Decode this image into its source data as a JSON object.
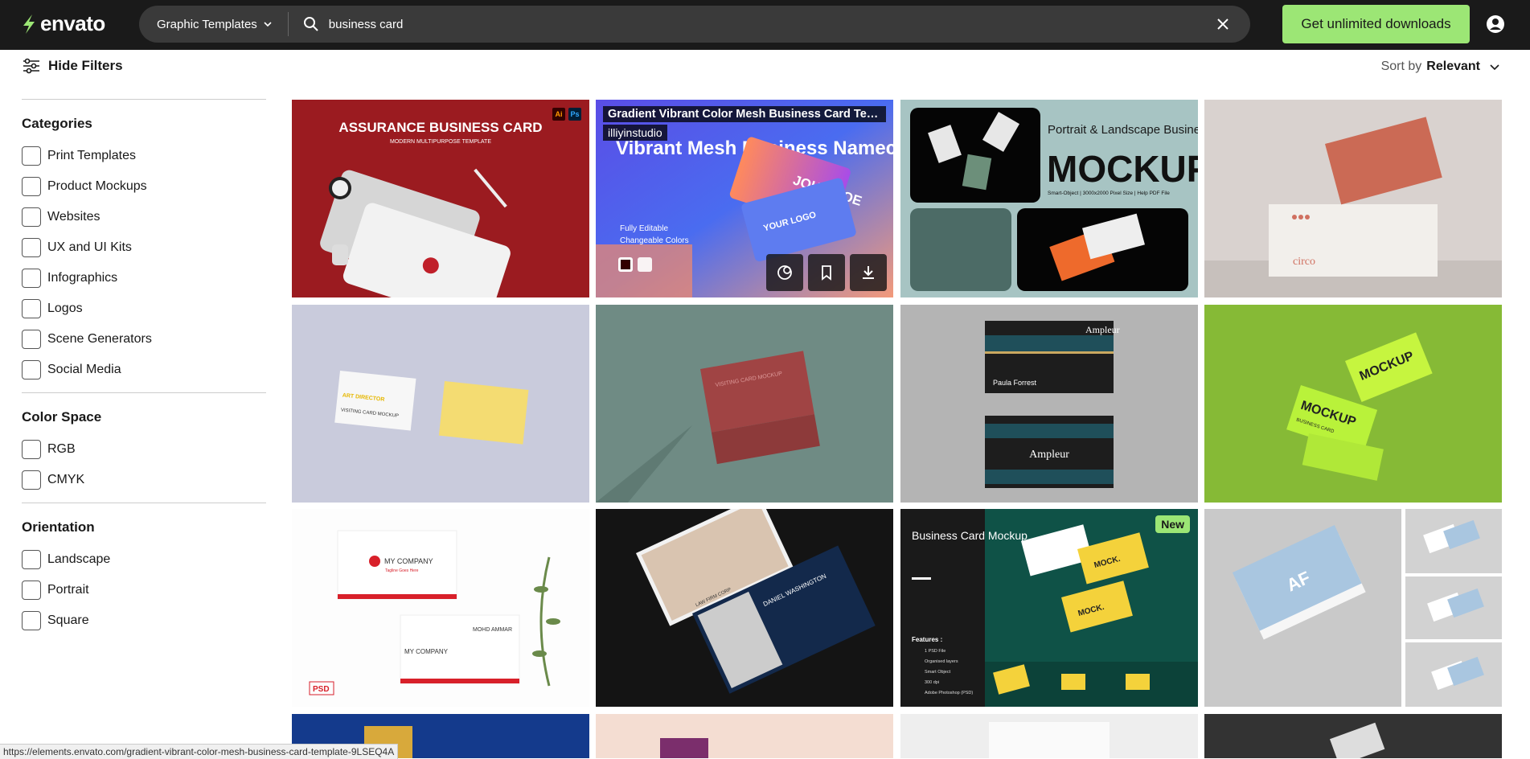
{
  "header": {
    "logo_text": "envato",
    "category": "Graphic Templates",
    "search_value": "business card",
    "cta_label": "Get unlimited downloads"
  },
  "toolbar": {
    "hide_filters_label": "Hide Filters",
    "sort_prefix": "Sort by",
    "sort_value": "Relevant"
  },
  "filters": {
    "categories": {
      "title": "Categories",
      "items": [
        "Print Templates",
        "Product Mockups",
        "Websites",
        "UX and UI Kits",
        "Infographics",
        "Logos",
        "Scene Generators",
        "Social Media"
      ]
    },
    "color_space": {
      "title": "Color Space",
      "items": [
        "RGB",
        "CMYK"
      ]
    },
    "orientation": {
      "title": "Orientation",
      "items": [
        "Landscape",
        "Portrait",
        "Square"
      ]
    }
  },
  "cards": [
    {
      "thumb_text": "ASSURANCE BUSINESS CARD",
      "thumb_sub": "MODERN MULTIPURPOSE TEMPLATE",
      "formats": [
        "Ai",
        "Ps"
      ],
      "bg": "#9e1c22"
    },
    {
      "title": "Gradient Vibrant Color Mesh Business Card Tem...",
      "author": "illiyinstudio",
      "thumb_text": "Vibrant Mesh Business Namecard",
      "thumb_bullets": [
        "Fully Editable",
        "Changeable Colors"
      ],
      "card_text_1": "JOHN DOE",
      "card_text_2": "YOUR LOGO"
    },
    {
      "thumb_text": "Portrait & Landscape Business Card",
      "thumb_big": "MOCKUP",
      "thumb_sub": "Smart-Object | 3000x2000 Pixel Size | Help PDF File"
    },
    {
      "thumb_text": "circo"
    },
    {
      "thumb_text": "ART DIRECTOR",
      "thumb_sub": "VISITING CARD MOCKUP"
    },
    {
      "thumb_text": "VISITING CARD MOCKUP"
    },
    {
      "thumb_text": "Ampleur",
      "thumb_sub": "Paula Forrest"
    },
    {
      "thumb_text": "MOCKUP",
      "thumb_sub": "BUSINESS CARD"
    },
    {
      "thumb_text": "MY COMPANY",
      "thumb_sub": "Tagline Goes Here",
      "thumb_name": "MOHD AMMAR",
      "format_tag": "PSD"
    },
    {
      "thumb_text": "DANIEL WASHINGTON",
      "thumb_sub": "LAW FIRM CORP"
    },
    {
      "thumb_text": "Business Card Mockup",
      "thumb_sub": "Features :",
      "thumb_list": [
        "1 PSD File",
        "Organised layers",
        "Smart Object",
        "300 dpi",
        "Adobe Photoshop (PSD)"
      ],
      "badge": "New",
      "thumb_brand": "MOCK."
    },
    {
      "thumb_text": "AF"
    }
  ],
  "status_url": "https://elements.envato.com/gradient-vibrant-color-mesh-business-card-template-9LSEQ4A"
}
